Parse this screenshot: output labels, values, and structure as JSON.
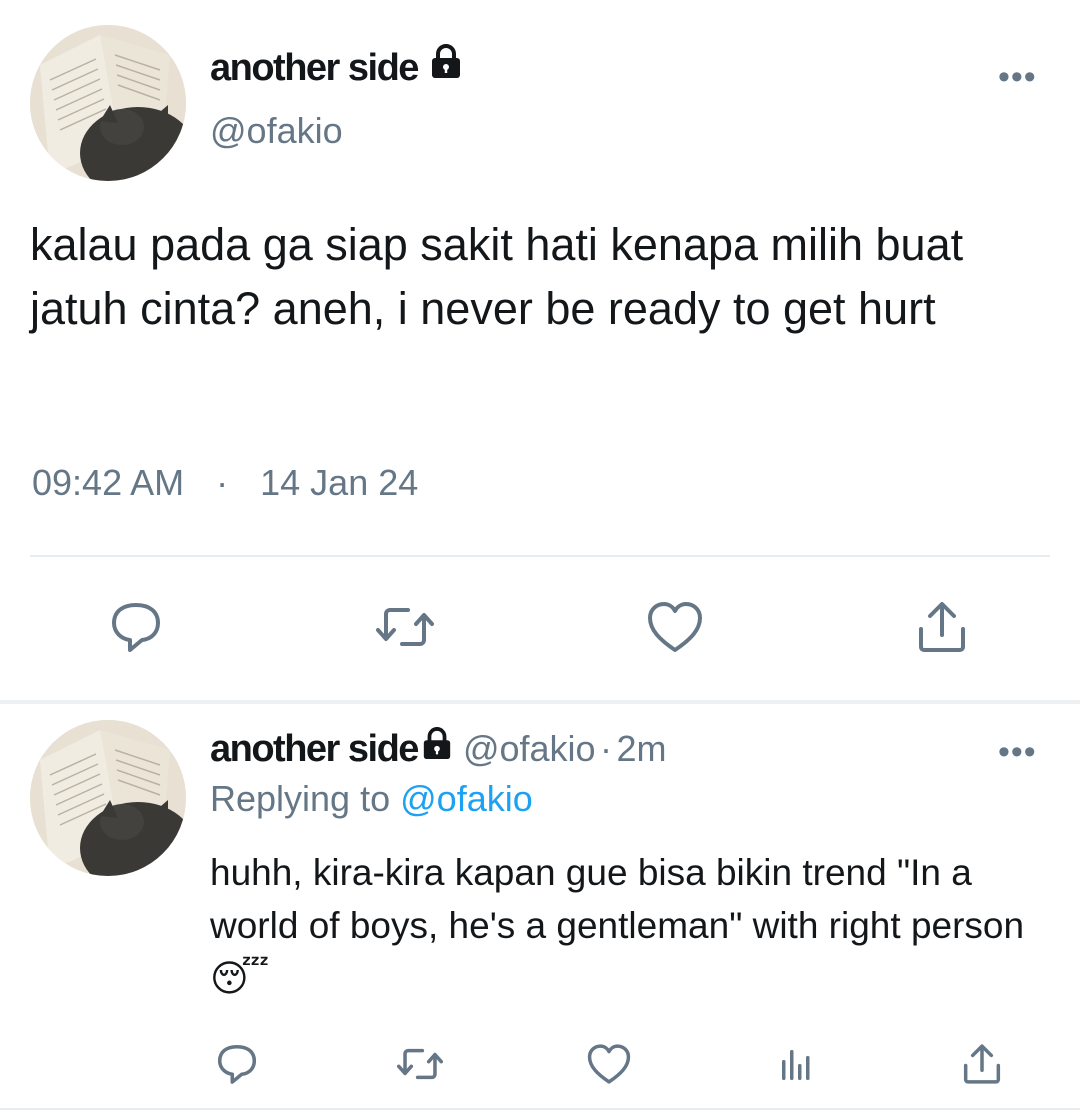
{
  "tweet": {
    "display_name": "another side",
    "handle": "@ofakio",
    "more_label": "•••",
    "text": "kalau pada ga siap sakit hati kenapa milih buat jatuh cinta? aneh, i never be ready to get hurt",
    "time": "09:42 AM",
    "separator": "·",
    "date": "14 Jan 24",
    "actions": [
      "reply-icon",
      "retweet-icon",
      "like-icon",
      "share-icon"
    ]
  },
  "reply": {
    "display_name": "another side",
    "handle": "@ofakio",
    "separator": "·",
    "age": "2m",
    "more_label": "•••",
    "replying_prefix": "Replying to",
    "replying_handle": "@ofakio",
    "text": "huhh, kira-kira kapan gue bisa bikin trend \"In a world of boys, he's a gentleman\" with right person",
    "emoji": "😴",
    "actions": [
      "reply-icon",
      "retweet-icon",
      "like-icon",
      "analytics-icon",
      "share-icon"
    ]
  },
  "colors": {
    "primary_text": "#14171a",
    "secondary_text": "#657786",
    "link": "#1da1f2",
    "divider": "#e6ecf0"
  }
}
